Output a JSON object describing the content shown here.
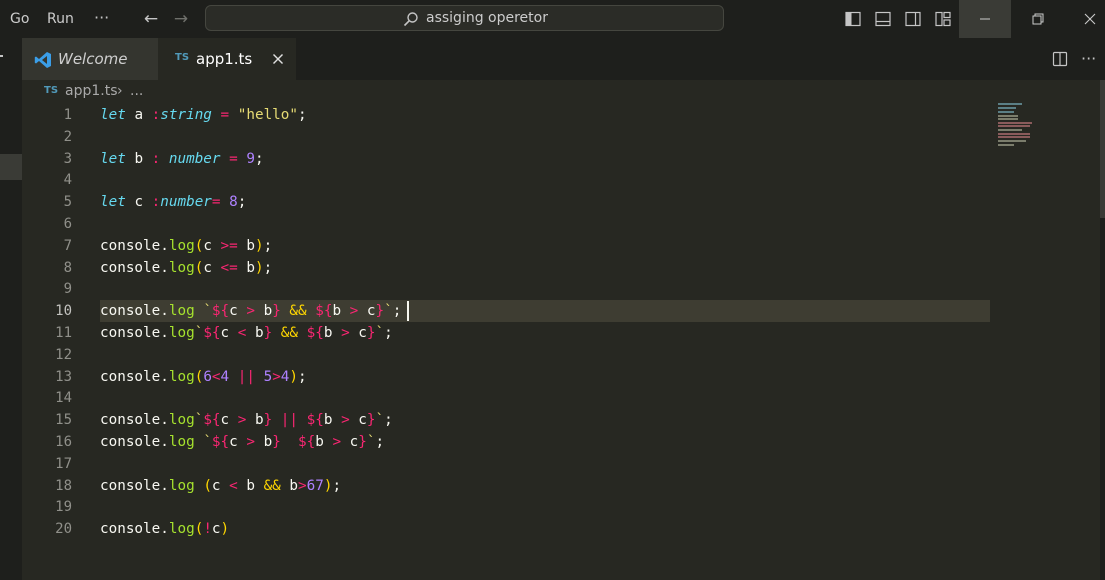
{
  "titlebar": {
    "menu": [
      "Go",
      "Run"
    ],
    "search_text": "assiging operetor"
  },
  "tabs": [
    {
      "label": "Welcome",
      "badge": ""
    },
    {
      "label": "app1.ts",
      "badge": "TS"
    }
  ],
  "breadcrumb": {
    "badge": "TS",
    "file": "app1.ts",
    "rest": "..."
  },
  "editor": {
    "active_line": 10,
    "lines": [
      {
        "n": "1",
        "text": "let a :string = \"hello\";"
      },
      {
        "n": "2",
        "text": ""
      },
      {
        "n": "3",
        "text": "let b : number = 9;"
      },
      {
        "n": "4",
        "text": ""
      },
      {
        "n": "5",
        "text": "let c :number= 8;"
      },
      {
        "n": "6",
        "text": ""
      },
      {
        "n": "7",
        "text": "console.log(c >= b);"
      },
      {
        "n": "8",
        "text": "console.log(c <= b);"
      },
      {
        "n": "9",
        "text": ""
      },
      {
        "n": "10",
        "text": "console.log `${c > b} && ${b > c}`;"
      },
      {
        "n": "11",
        "text": "console.log`${c < b} && ${b > c}`;"
      },
      {
        "n": "12",
        "text": ""
      },
      {
        "n": "13",
        "text": "console.log(6<4 || 5>4);"
      },
      {
        "n": "14",
        "text": ""
      },
      {
        "n": "15",
        "text": "console.log`${c > b} || ${b > c}`;"
      },
      {
        "n": "16",
        "text": "console.log `${c > b}  ${b > c}`;"
      },
      {
        "n": "17",
        "text": ""
      },
      {
        "n": "18",
        "text": "console.log (c < b && b>67);"
      },
      {
        "n": "19",
        "text": ""
      },
      {
        "n": "20",
        "text": "console.log(!c)"
      }
    ]
  },
  "colors": {
    "keyword": "#66d9ef",
    "operator": "#f92672",
    "string": "#e6db74",
    "number": "#ae81ff",
    "function": "#a6e22e",
    "bracket": "#ffd700",
    "background": "#272822"
  }
}
